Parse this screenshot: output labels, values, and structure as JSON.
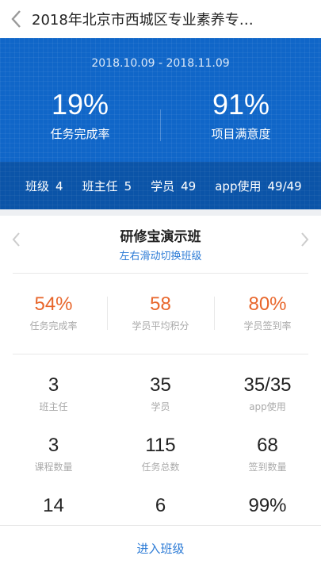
{
  "header": {
    "title": "2018年北京市西城区专业素养专…"
  },
  "summary": {
    "date_range": "2018.10.09 - 2018.11.09",
    "task_completion": {
      "value": "19%",
      "label": "任务完成率"
    },
    "satisfaction": {
      "value": "91%",
      "label": "项目满意度"
    }
  },
  "stats": [
    {
      "label": "班级",
      "value": "4"
    },
    {
      "label": "班主任",
      "value": "5"
    },
    {
      "label": "学员",
      "value": "49"
    },
    {
      "label": "app使用",
      "value": "49/49"
    }
  ],
  "class_card": {
    "name": "研修宝演示班",
    "hint": "左右滑动切换班级",
    "rates": [
      {
        "value": "54%",
        "label": "任务完成率"
      },
      {
        "value": "58",
        "label": "学员平均积分"
      },
      {
        "value": "80%",
        "label": "学员签到率"
      }
    ],
    "metrics": [
      {
        "value": "3",
        "label": "班主任"
      },
      {
        "value": "35",
        "label": "学员"
      },
      {
        "value": "35/35",
        "label": "app使用"
      },
      {
        "value": "3",
        "label": "课程数量"
      },
      {
        "value": "115",
        "label": "任务总数"
      },
      {
        "value": "68",
        "label": "签到数量"
      },
      {
        "value": "14",
        "label": ""
      },
      {
        "value": "6",
        "label": ""
      },
      {
        "value": "99%",
        "label": ""
      }
    ]
  },
  "footer": {
    "enter_label": "进入班级"
  }
}
